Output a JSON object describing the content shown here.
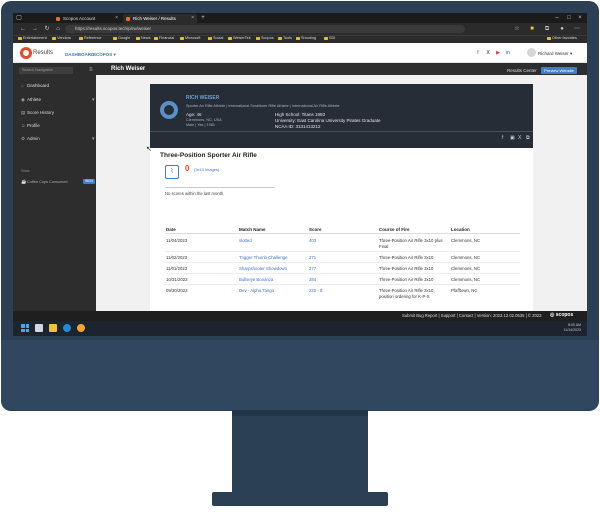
{
  "browser": {
    "tabs": [
      {
        "label": "Scopos Account",
        "active": false
      },
      {
        "label": "Rich Weiser / Results",
        "active": true
      }
    ],
    "url": "https://results.scopos.tech/p/rw/weiser",
    "favorites": [
      "Entertainment",
      "Vendors",
      "Reference",
      "Google",
      "News",
      "Financial",
      "Microsoft",
      "Social",
      "WeiserTek",
      "Scopos",
      "Tools",
      "Shooting",
      "SDI"
    ],
    "other_favorites": "Other favorites"
  },
  "header": {
    "logo_text": "Results",
    "nav": [
      "DASHBOARD",
      "SCOPOS"
    ],
    "user_name": "Richard Weiser"
  },
  "sidebar": {
    "search_placeholder": "Search Navigation",
    "items": [
      {
        "label": "Dashboard",
        "icon": "home-icon"
      },
      {
        "label": "Athlete",
        "icon": "user-icon"
      },
      {
        "label": "Score History",
        "icon": "list-icon"
      },
      {
        "label": "Profile",
        "icon": "person-icon"
      },
      {
        "label": "Admin",
        "icon": "gear-icon"
      }
    ],
    "section_header": "Stats",
    "counter_label": "Coffee Cups Consumed",
    "counter_value": "9634"
  },
  "topbar": {
    "title": "Rich Weiser",
    "results_center": "Results Center",
    "preview_button": "Preview Website"
  },
  "profile": {
    "name": "RICH WEISER",
    "subtitle": "Sporter Air Rifle Athlete  |  International Smallbore Rifle Athlete  |  International Air Rifle Athlete",
    "age": "Age: 46",
    "location": "Clemmons, NC, USA",
    "meta": "Male  |  Yes  |  1981",
    "school": "High School: Titans 1993",
    "university": "University: East Carolina University Pirates Graduate",
    "ncaa_id": "NCAA ID: 3131413212"
  },
  "main": {
    "section_title": "Three-Position Sporter Air Rifle",
    "stat_value": "0",
    "stat_sub": "(3x10 images)",
    "no_scores": "No scores within the last month.",
    "table": {
      "headers": [
        "Date",
        "Match Name",
        "Score",
        "Course of Fire",
        "Location"
      ],
      "rows": [
        {
          "date": "11/04/2023",
          "match": "slotted",
          "score": "403",
          "course": [
            "Three-Position Air Rifle 3x10 plus",
            "Final"
          ],
          "location": "Clemmons, NC"
        },
        {
          "date": "11/02/2023",
          "match": "Trigger Thumb Challenge",
          "score": "271",
          "course": [
            "Three-Position Air Rifle 3x10"
          ],
          "location": "Clemmons, NC"
        },
        {
          "date": "11/01/2023",
          "match": "Sharpshooter Showdown",
          "score": "277",
          "course": [
            "Three-Position Air Rifle 3x10"
          ],
          "location": "Clemmons, NC"
        },
        {
          "date": "10/31/2023",
          "match": "Bullseye Bonanza",
          "score": "284",
          "course": [
            "Three-Position Air Rifle 3x10"
          ],
          "location": "Clemmons, NC"
        },
        {
          "date": "09/30/2023",
          "match": "Dev - Alpha Tango",
          "score": "220 - 8",
          "course": [
            "Three-Position Air Rifle 3x10,",
            "position ordering for K-P-S"
          ],
          "location": "Pfafftown, NC"
        }
      ]
    }
  },
  "footer": {
    "text": "Submit Bug Report | Support | Contact | Version: 2023.12.02.0535 | © 2023",
    "brand": "scopos"
  },
  "taskbar": {
    "time": "8:00 AM",
    "date": "11/14/2023"
  }
}
